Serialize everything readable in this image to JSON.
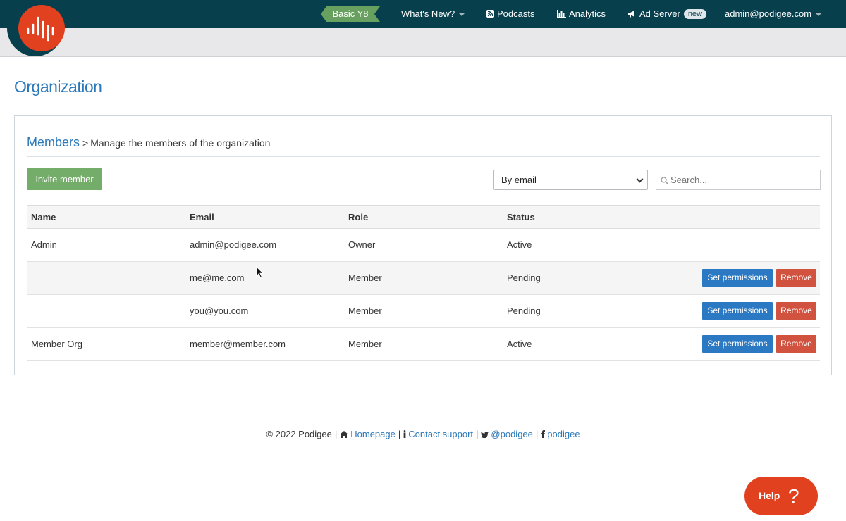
{
  "nav": {
    "plan": "Basic Y8",
    "whats_new": "What's New?",
    "podcasts": "Podcasts",
    "analytics": "Analytics",
    "ad_server": "Ad Server",
    "ad_server_badge": "new",
    "account": "admin@podigee.com"
  },
  "page": {
    "title": "Organization"
  },
  "members_panel": {
    "section": "Members",
    "separator": ">",
    "description": "Manage the members of the organization",
    "invite_label": "Invite member",
    "filter_selected": "By email",
    "search_placeholder": "Search..."
  },
  "table": {
    "headers": [
      "Name",
      "Email",
      "Role",
      "Status"
    ],
    "rows": [
      {
        "name": "Admin",
        "email": "admin@podigee.com",
        "role": "Owner",
        "status": "Active"
      },
      {
        "name": "",
        "email": "me@me.com",
        "role": "Member",
        "status": "Pending"
      },
      {
        "name": "",
        "email": "you@you.com",
        "role": "Member",
        "status": "Pending"
      },
      {
        "name": "Member Org",
        "email": "member@member.com",
        "role": "Member",
        "status": "Active"
      }
    ],
    "set_permissions_label": "Set permissions",
    "remove_label": "Remove"
  },
  "footer": {
    "copyright": "© 2022 Podigee",
    "homepage": "Homepage",
    "contact": "Contact support",
    "twitter": "@podigee",
    "facebook": "podigee"
  },
  "help": {
    "label": "Help",
    "icon_glyph": "?"
  },
  "colors": {
    "nav_bg": "#083f4c",
    "brand": "#e2411f",
    "link": "#2b78b9",
    "plan_green": "#68a05f",
    "primary_button": "#2b79c2",
    "danger_button": "#d0523f"
  },
  "icons": [
    "podigee-logo-icon",
    "rss-icon",
    "bar-chart-icon",
    "megaphone-icon",
    "search-icon",
    "home-icon",
    "info-icon",
    "twitter-icon",
    "facebook-icon",
    "mouse-cursor-icon"
  ]
}
